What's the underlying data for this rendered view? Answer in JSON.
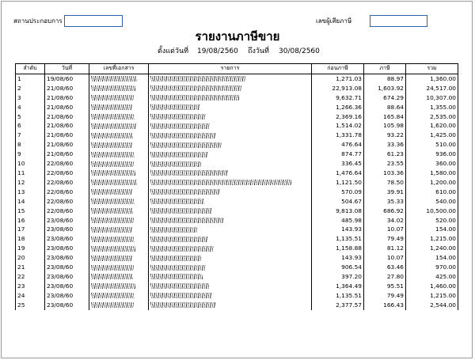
{
  "header": {
    "company_label": "สถานประกอบการ",
    "taxid_label": "เลขผู้เสียภาษี",
    "title": "รายงานภาษีขาย",
    "from_label": "ตั้งแต่วันที่",
    "from_date": "19/08/2560",
    "to_label": "ถึงวันที่",
    "to_date": "30/08/2560"
  },
  "table": {
    "columns": [
      "ลำดับ",
      "วันที่",
      "เลขที่เอกสาร",
      "รายการ",
      "ก่อนภาษี",
      "ภาษี",
      "รวม"
    ],
    "rows": [
      {
        "no": "1",
        "date": "19/08/60",
        "before_tax": "1,271.03",
        "vat": "88.97",
        "total": "1,360.00"
      },
      {
        "no": "2",
        "date": "21/08/60",
        "before_tax": "22,913.08",
        "vat": "1,603.92",
        "total": "24,517.00"
      },
      {
        "no": "3",
        "date": "21/08/60",
        "before_tax": "9,632.71",
        "vat": "674.29",
        "total": "10,307.00"
      },
      {
        "no": "4",
        "date": "21/08/60",
        "before_tax": "1,266.36",
        "vat": "88.64",
        "total": "1,355.00"
      },
      {
        "no": "5",
        "date": "21/08/60",
        "before_tax": "2,369.16",
        "vat": "165.84",
        "total": "2,535.00"
      },
      {
        "no": "6",
        "date": "21/08/60",
        "before_tax": "1,514.02",
        "vat": "105.98",
        "total": "1,620.00"
      },
      {
        "no": "7",
        "date": "21/08/60",
        "before_tax": "1,331.78",
        "vat": "93.22",
        "total": "1,425.00"
      },
      {
        "no": "8",
        "date": "21/08/60",
        "before_tax": "476.64",
        "vat": "33.36",
        "total": "510.00"
      },
      {
        "no": "9",
        "date": "21/08/60",
        "before_tax": "874.77",
        "vat": "61.23",
        "total": "936.00"
      },
      {
        "no": "10",
        "date": "22/08/60",
        "before_tax": "336.45",
        "vat": "23.55",
        "total": "360.00"
      },
      {
        "no": "11",
        "date": "22/08/60",
        "before_tax": "1,476.64",
        "vat": "103.36",
        "total": "1,580.00"
      },
      {
        "no": "12",
        "date": "22/08/60",
        "before_tax": "1,121.50",
        "vat": "78.50",
        "total": "1,200.00"
      },
      {
        "no": "13",
        "date": "22/08/60",
        "before_tax": "570.09",
        "vat": "39.91",
        "total": "610.00"
      },
      {
        "no": "14",
        "date": "22/08/60",
        "before_tax": "504.67",
        "vat": "35.33",
        "total": "540.00"
      },
      {
        "no": "15",
        "date": "22/08/60",
        "before_tax": "9,813.08",
        "vat": "686.92",
        "total": "10,500.00"
      },
      {
        "no": "16",
        "date": "23/08/60",
        "before_tax": "485.98",
        "vat": "34.02",
        "total": "520.00"
      },
      {
        "no": "17",
        "date": "23/08/60",
        "before_tax": "143.93",
        "vat": "10.07",
        "total": "154.00"
      },
      {
        "no": "18",
        "date": "23/08/60",
        "before_tax": "1,135.51",
        "vat": "79.49",
        "total": "1,215.00"
      },
      {
        "no": "19",
        "date": "23/08/60",
        "before_tax": "1,158.88",
        "vat": "81.12",
        "total": "1,240.00"
      },
      {
        "no": "20",
        "date": "23/08/60",
        "before_tax": "143.93",
        "vat": "10.07",
        "total": "154.00"
      },
      {
        "no": "21",
        "date": "23/08/60",
        "before_tax": "906.54",
        "vat": "63.46",
        "total": "970.00"
      },
      {
        "no": "22",
        "date": "23/08/60",
        "before_tax": "397.20",
        "vat": "27.80",
        "total": "425.00"
      },
      {
        "no": "23",
        "date": "23/08/60",
        "before_tax": "1,364.49",
        "vat": "95.51",
        "total": "1,460.00"
      },
      {
        "no": "24",
        "date": "23/08/60",
        "before_tax": "1,135.51",
        "vat": "79.49",
        "total": "1,215.00"
      },
      {
        "no": "25",
        "date": "23/08/60",
        "before_tax": "2,377.57",
        "vat": "166.43",
        "total": "2,544.00"
      }
    ]
  }
}
